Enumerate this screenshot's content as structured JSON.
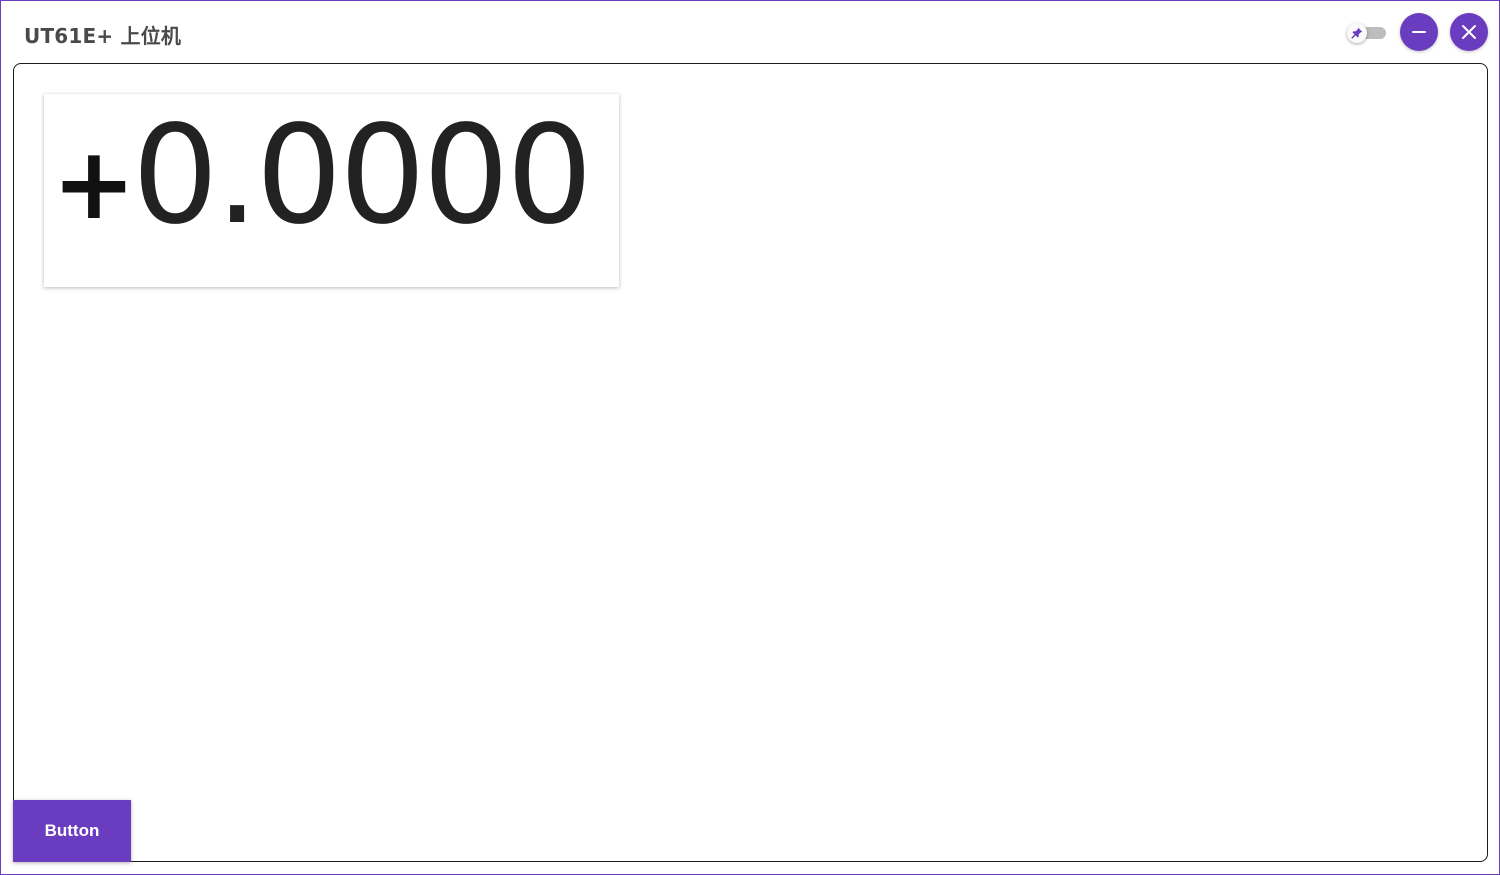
{
  "window": {
    "title": "UT61E+ 上位机"
  },
  "title_bar": {
    "pin_toggle": {
      "icon": "pin-icon",
      "state": "off"
    },
    "minimize": {
      "icon": "minus-icon"
    },
    "close": {
      "icon": "close-icon"
    }
  },
  "reading": {
    "sign": "+",
    "value": "0.0000"
  },
  "actions": {
    "button_label": "Button"
  },
  "colors": {
    "accent": "#6a3cc0",
    "toggle_track": "#bdbdbd",
    "panel_border": "#1b1b1b",
    "title_text": "#4a4a4a"
  }
}
